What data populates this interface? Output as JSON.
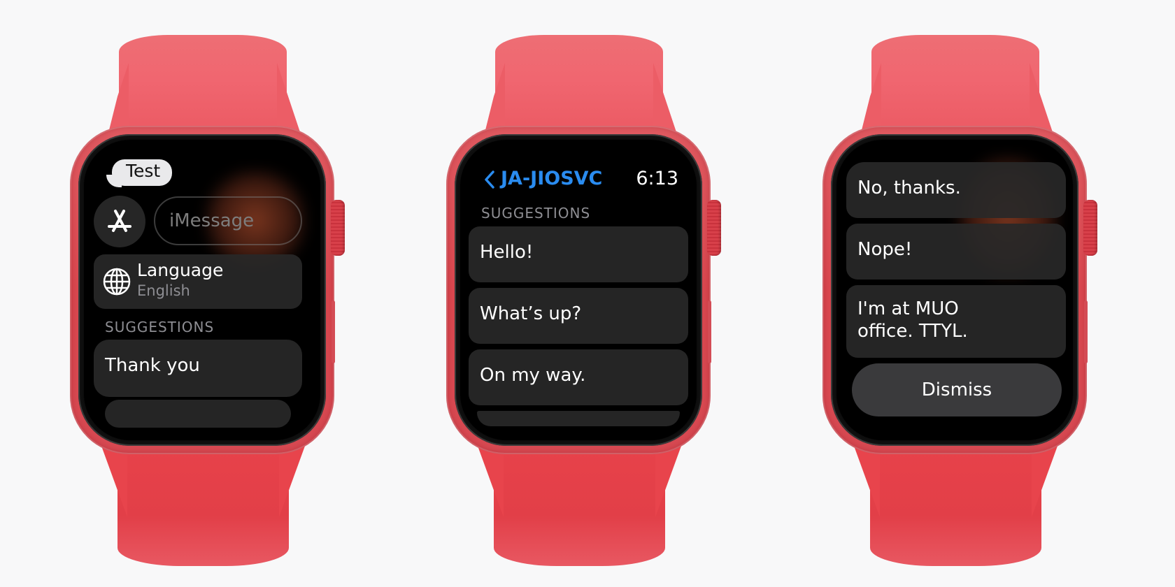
{
  "watches": [
    {
      "bubble_text": "Test",
      "appstore_icon": "app-store-icon",
      "imessage_placeholder": "iMessage",
      "language": {
        "icon": "globe-icon",
        "title": "Language",
        "value": "English"
      },
      "section_label": "SUGGESTIONS",
      "suggestions": [
        "Thank you"
      ]
    },
    {
      "back_icon": "chevron-left-icon",
      "contact": "JA-JIOSVC",
      "time": "6:13",
      "section_label": "SUGGESTIONS",
      "suggestions": [
        "Hello!",
        "What’s up?",
        "On my way."
      ]
    },
    {
      "suggestions": [
        "No, thanks.",
        "Nope!",
        "I'm at MUO office. TTYL."
      ],
      "dismiss_label": "Dismiss"
    }
  ],
  "colors": {
    "band": "#ea5760",
    "case": "#d9474f",
    "link_blue": "#2a8cf0",
    "card_bg": "#282828",
    "background": "#f8f8f9"
  }
}
